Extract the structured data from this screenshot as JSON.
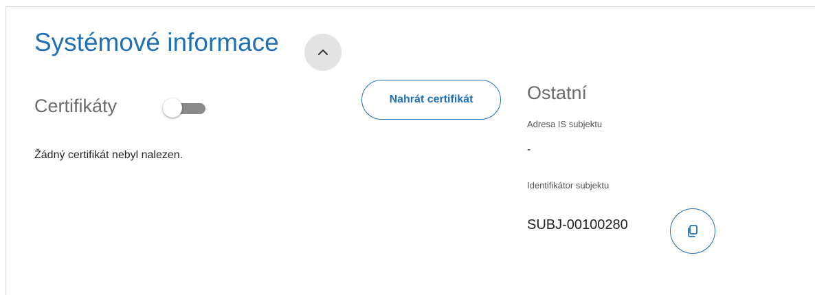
{
  "section": {
    "title": "Systémové informace",
    "collapse_icon": "chevron-up-icon"
  },
  "certificates": {
    "label": "Certifikáty",
    "toggle_on": false,
    "upload_button": "Nahrát certifikát",
    "empty_message": "Žádný certifikát nebyl nalezen."
  },
  "other": {
    "title": "Ostatní",
    "is_address_label": "Adresa IS subjektu",
    "is_address_value": "-",
    "subject_id_label": "Identifikátor subjektu",
    "subject_id_value": "SUBJ-00100280",
    "copy_icon": "copy-icon"
  },
  "colors": {
    "accent": "#1f6fb4",
    "muted_text": "#6b6b6b",
    "toggle_track": "#8a8a8a",
    "collapse_bg": "#e3e3e3"
  }
}
